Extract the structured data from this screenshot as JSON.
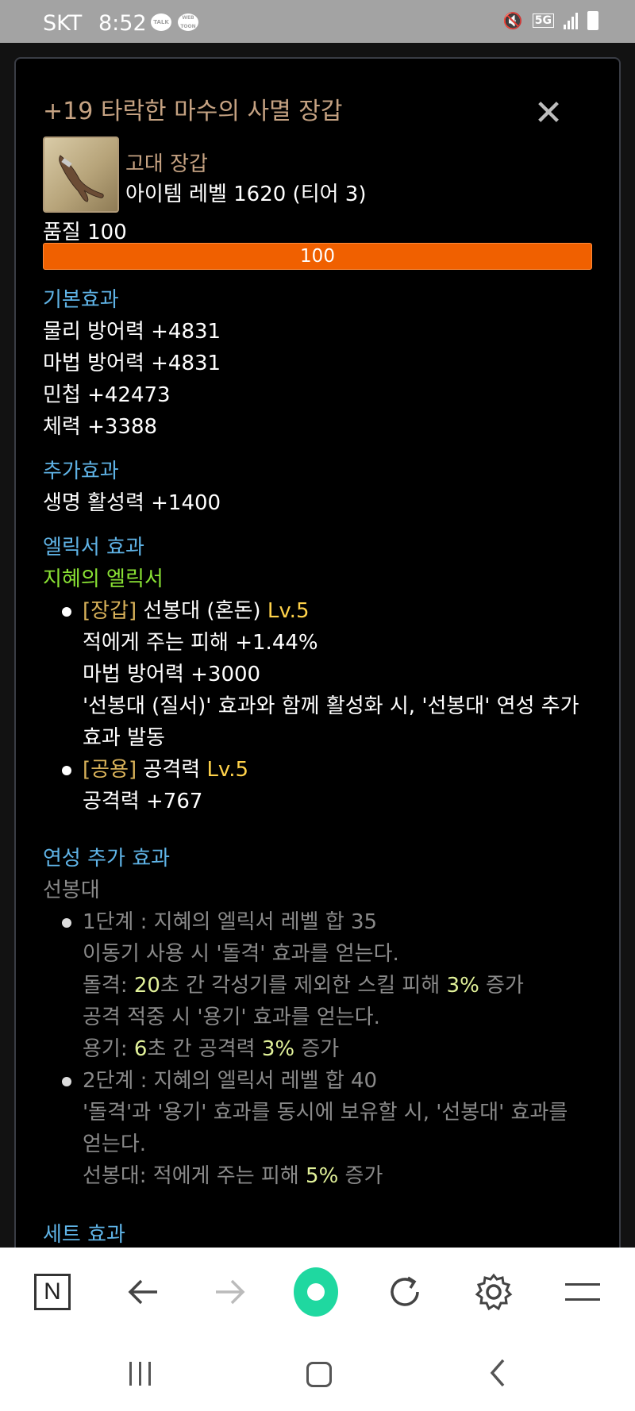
{
  "status_bar": {
    "carrier": "SKT",
    "time": "8:52",
    "app_icon_1": "TALK",
    "app_icon_2": "WEB TOON",
    "network": "5G"
  },
  "item": {
    "title": "+19 타락한 마수의 사멸 장갑",
    "type": "고대 장갑",
    "item_level": "아이템 레벨 1620 (티어 3)",
    "quality_label": "품질 100",
    "quality_value": "100",
    "quality_fraction": 1.0
  },
  "basic_effect": {
    "heading": "기본효과",
    "lines": [
      "물리 방어력 +4831",
      "마법 방어력 +4831",
      "민첩 +42473",
      "체력 +3388"
    ]
  },
  "additional_effect": {
    "heading": "추가효과",
    "lines": [
      "생명 활성력 +1400"
    ]
  },
  "elixir": {
    "heading": "엘릭서 효과",
    "name": "지혜의 엘릭서",
    "options": [
      {
        "slot": "[장갑]",
        "name": "선봉대 (혼돈)",
        "level": "Lv.5",
        "lines": [
          "적에게 주는 피해 +1.44%",
          "마법 방어력 +3000",
          "'선봉대 (질서)' 효과와 함께 활성화 시, '선봉대' 연성 추가",
          "효과 발동"
        ]
      },
      {
        "slot": "[공용]",
        "name": "공격력",
        "level": "Lv.5",
        "lines": [
          "공격력 +767"
        ]
      }
    ]
  },
  "synthesis": {
    "heading": "연성 추가 효과",
    "name": "선봉대",
    "stage1": {
      "title": "1단계 : 지혜의 엘릭서 레벨 합 35",
      "line1": "이동기 사용 시 '돌격' 효과를 얻는다.",
      "line2_a": "돌격: ",
      "line2_b": "20",
      "line2_c": "초 간 각성기를 제외한 스킬 피해 ",
      "line2_d": "3%",
      "line2_e": " 증가",
      "line3": "공격 적중 시 '용기' 효과를 얻는다.",
      "line4_a": "용기: ",
      "line4_b": "6",
      "line4_c": "초 간 공격력 ",
      "line4_d": "3%",
      "line4_e": " 증가"
    },
    "stage2": {
      "title": "2단계 : 지혜의 엘릭서 레벨 합 40",
      "line1": "'돌격'과 '용기' 효과를 동시에 보유할 시, '선봉대' 효과를",
      "line2": "얻는다.",
      "line3_a": "선봉대: 적에게 주는 피해 ",
      "line3_b": "5%",
      "line3_c": " 증가"
    }
  },
  "set_effect": {
    "heading": "세트 효과"
  },
  "colors": {
    "title": "#c5a282",
    "section": "#5fb3e6",
    "elixir": "#8ae234",
    "level": "#ffd24a",
    "quality_bar": "#f06000"
  },
  "icons": [
    "close-icon",
    "naver-icon",
    "back-arrow-icon",
    "forward-arrow-icon",
    "green-dot-icon",
    "refresh-icon",
    "settings-icon",
    "menu-icon"
  ]
}
